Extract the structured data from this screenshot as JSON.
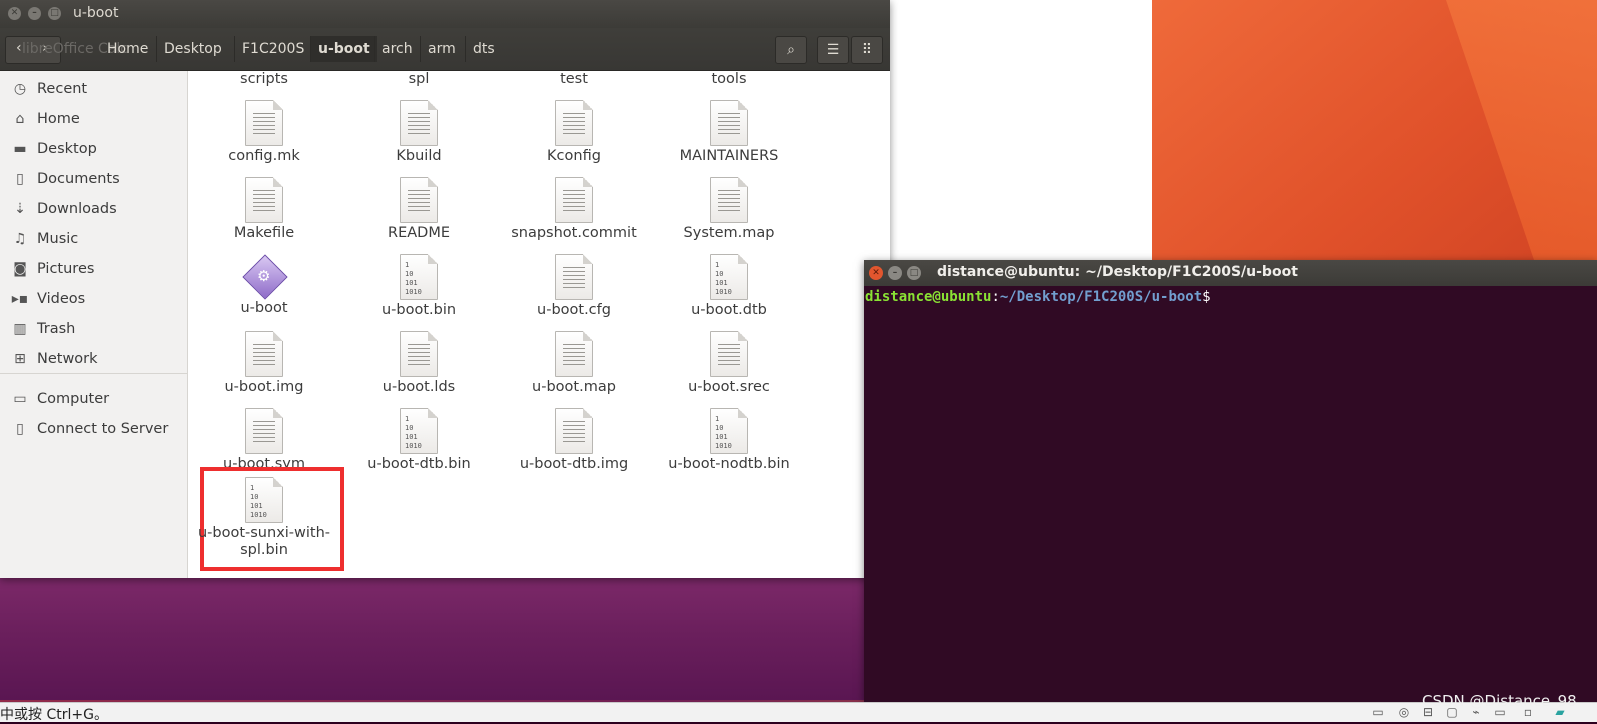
{
  "file_manager": {
    "title": "u-boot",
    "back_overlay_text": "libreOffice Calc",
    "breadcrumbs": [
      "Home",
      "Desktop",
      "F1C200S",
      "u-boot",
      "arch",
      "arm",
      "dts"
    ],
    "sidebar": {
      "items": [
        {
          "label": "Recent",
          "icon": "clock-icon"
        },
        {
          "label": "Home",
          "icon": "home-icon"
        },
        {
          "label": "Desktop",
          "icon": "folder-icon"
        },
        {
          "label": "Documents",
          "icon": "document-icon"
        },
        {
          "label": "Downloads",
          "icon": "download-icon"
        },
        {
          "label": "Music",
          "icon": "music-icon"
        },
        {
          "label": "Pictures",
          "icon": "camera-icon"
        },
        {
          "label": "Videos",
          "icon": "video-icon"
        },
        {
          "label": "Trash",
          "icon": "trash-icon"
        },
        {
          "label": "Network",
          "icon": "network-icon"
        },
        {
          "label": "Computer",
          "icon": "computer-icon"
        },
        {
          "label": "Connect to Server",
          "icon": "server-icon"
        }
      ]
    },
    "files": [
      {
        "name": "scripts"
      },
      {
        "name": "spl"
      },
      {
        "name": "test"
      },
      {
        "name": "tools"
      },
      {
        "name": "config.mk",
        "icon": "text-file-icon"
      },
      {
        "name": "Kbuild",
        "icon": "text-file-icon"
      },
      {
        "name": "Kconfig",
        "icon": "text-file-icon"
      },
      {
        "name": "MAINTAINERS",
        "icon": "text-file-icon"
      },
      {
        "name": "Makefile",
        "icon": "text-file-icon"
      },
      {
        "name": "README",
        "icon": "text-file-icon"
      },
      {
        "name": "snapshot.commit",
        "icon": "text-file-icon"
      },
      {
        "name": "System.map",
        "icon": "text-file-icon"
      },
      {
        "name": "u-boot",
        "icon": "executable-icon"
      },
      {
        "name": "u-boot.bin",
        "icon": "binary-file-icon"
      },
      {
        "name": "u-boot.cfg",
        "icon": "text-file-icon"
      },
      {
        "name": "u-boot.dtb",
        "icon": "binary-file-icon"
      },
      {
        "name": "u-boot.img",
        "icon": "text-file-icon"
      },
      {
        "name": "u-boot.lds",
        "icon": "text-file-icon"
      },
      {
        "name": "u-boot.map",
        "icon": "text-file-icon"
      },
      {
        "name": "u-boot.srec",
        "icon": "text-file-icon"
      },
      {
        "name": "u-boot.sym",
        "icon": "text-file-icon"
      },
      {
        "name": "u-boot-dtb.bin",
        "icon": "binary-file-icon"
      },
      {
        "name": "u-boot-dtb.img",
        "icon": "text-file-icon"
      },
      {
        "name": "u-boot-nodtb.bin",
        "icon": "binary-file-icon"
      },
      {
        "name": "u-boot-sunxi-with-spl.bin",
        "icon": "binary-file-icon",
        "highlighted": true
      }
    ],
    "binary_glyph": "1\n10\n101\n1010",
    "highlight_color": "#ee2e2e"
  },
  "terminal": {
    "title": "distance@ubuntu: ~/Desktop/F1C200S/u-boot",
    "prompt_user": "distance@ubuntu",
    "prompt_colon": ":",
    "prompt_path": "~/Desktop/F1C200S/u-boot",
    "prompt_dollar": "$",
    "background": "#300a24",
    "user_color": "#8ae234",
    "path_color": "#729fcf"
  },
  "bottom_bar": {
    "hint_text": "中或按 Ctrl+G。",
    "watermark": "CSDN @Distance_98"
  }
}
